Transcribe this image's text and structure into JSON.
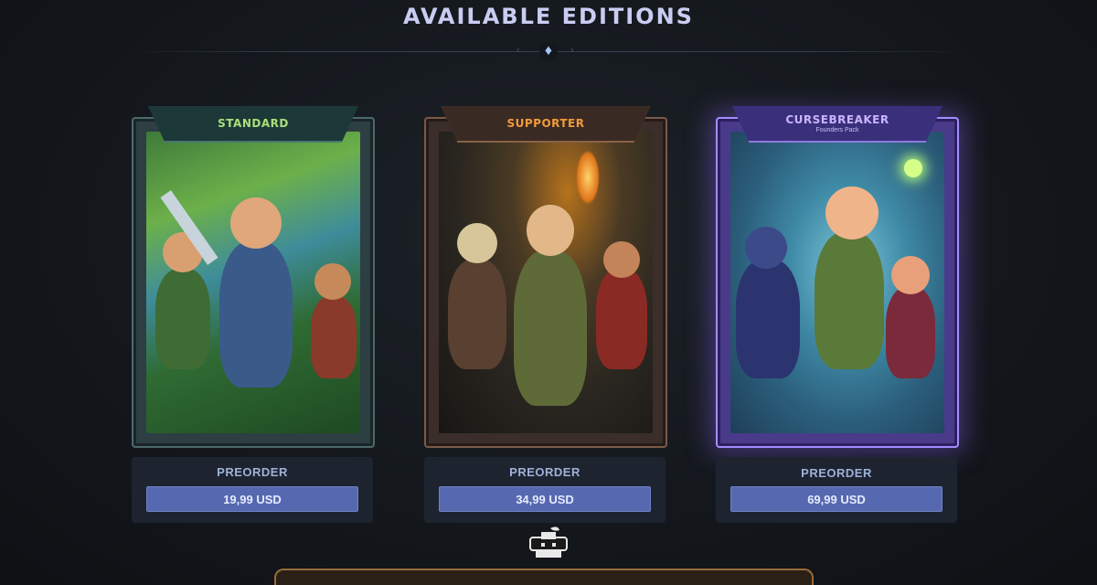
{
  "header": {
    "title": "AVAILABLE EDITIONS"
  },
  "editions": [
    {
      "name": "STANDARD",
      "subtitle": "",
      "action_label": "PREORDER",
      "price": "19,99 USD",
      "accent": "#a8e07a"
    },
    {
      "name": "SUPPORTER",
      "subtitle": "",
      "action_label": "PREORDER",
      "price": "34,99 USD",
      "accent": "#f29b3a"
    },
    {
      "name": "CURSEBREAKER",
      "subtitle": "Founders Pack",
      "action_label": "PREORDER",
      "price": "69,99 USD",
      "accent": "#c9b4ff"
    }
  ],
  "colors": {
    "price_button": "#5669b0",
    "title": "#c9cdf2",
    "background": "#14181d"
  },
  "icons": {
    "divider": "diamond-icon",
    "mascot": "cauldron-mascot-icon"
  }
}
